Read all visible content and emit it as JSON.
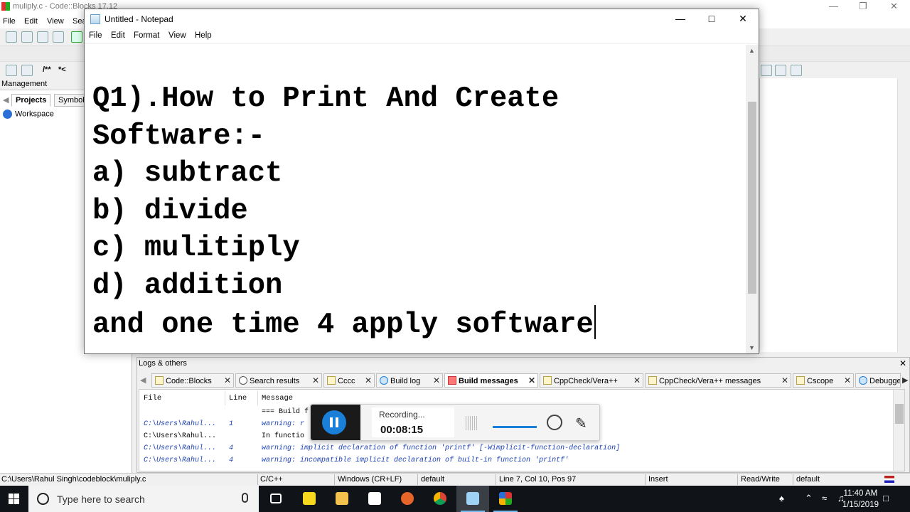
{
  "codeblocks": {
    "title": "muliply.c - Code::Blocks 17.12",
    "menu": [
      "File",
      "Edit",
      "View",
      "Sea"
    ],
    "toolbar_comment_buttons": [
      "/**",
      "*<"
    ],
    "management_label": "Management",
    "tabs": [
      "Projects",
      "Symbols"
    ],
    "workspace": "Workspace"
  },
  "notepad": {
    "title": "Untitled - Notepad",
    "menu": [
      "File",
      "Edit",
      "Format",
      "View",
      "Help"
    ],
    "lines": [
      "Q1).How to Print And Create",
      "Software:-",
      "a) subtract",
      "b) divide",
      "c) mulitiply",
      "d) addition",
      "and one time 4 apply software"
    ]
  },
  "logs": {
    "title": "Logs & others",
    "tabs": [
      "Code::Blocks",
      "Search results",
      "Cccc",
      "Build log",
      "Build messages",
      "CppCheck/Vera++",
      "CppCheck/Vera++ messages",
      "Cscope",
      "Debugge"
    ],
    "active_tab": "Build messages",
    "columns": [
      "File",
      "Line",
      "Message"
    ],
    "rows": [
      {
        "file": "",
        "line": "",
        "message": "=== Build f",
        "style": "normal"
      },
      {
        "file": "C:\\Users\\Rahul...",
        "line": "1",
        "message": "warning: r",
        "style": "warning"
      },
      {
        "file": "C:\\Users\\Rahul...",
        "line": "",
        "message": "In functio",
        "style": "normal"
      },
      {
        "file": "C:\\Users\\Rahul...",
        "line": "4",
        "message": "warning: implicit declaration of function 'printf' [-Wimplicit-function-declaration]",
        "style": "warning"
      },
      {
        "file": "C:\\Users\\Rahul...",
        "line": "4",
        "message": "warning: incompatible implicit declaration of built-in function 'printf'",
        "style": "warning"
      }
    ]
  },
  "recorder": {
    "status": "Recording...",
    "time": "00:08:15",
    "volume_fraction": 0.9
  },
  "statusbar": {
    "path": "C:\\Users\\Rahul Singh\\codeblock\\muliply.c",
    "lang": "C/C++",
    "eol": "Windows (CR+LF)",
    "encoding": "default",
    "position": "Line 7, Col 10, Pos 97",
    "mode": "Insert",
    "access": "Read/Write",
    "extra": "default"
  },
  "taskbar": {
    "search_placeholder": "Type here to search",
    "time": "11:40 AM",
    "date": "1/15/2019",
    "apps": [
      "task-view-icon",
      "sticky-notes-icon",
      "file-explorer-icon",
      "store-icon",
      "firefox-icon",
      "chrome-icon",
      "notepad-icon",
      "codeblocks-icon"
    ]
  },
  "colors": {
    "accent": "#1a7fd8",
    "warning_text": "#1a3fb0",
    "taskbar": "#101418"
  }
}
